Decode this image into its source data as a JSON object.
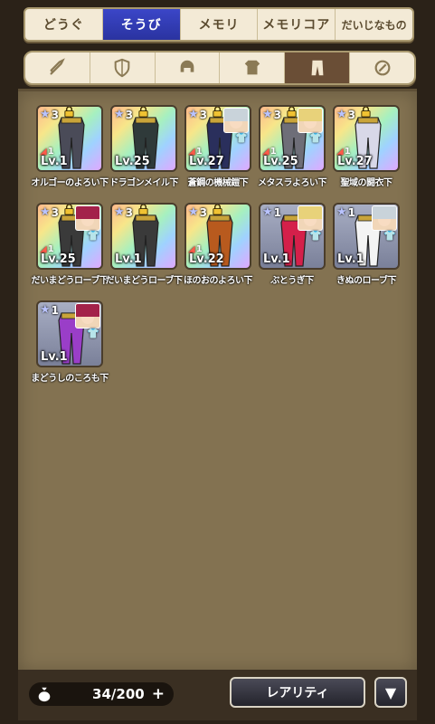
{
  "top_tabs": [
    {
      "label": "どうぐ",
      "active": false
    },
    {
      "label": "そうび",
      "active": true
    },
    {
      "label": "メモリ",
      "active": false
    },
    {
      "label": "メモリコア",
      "active": false
    },
    {
      "label": "だいじなもの",
      "active": false
    }
  ],
  "category_tabs": [
    {
      "icon": "sword-icon",
      "active": false
    },
    {
      "icon": "shield-icon",
      "active": false
    },
    {
      "icon": "helmet-icon",
      "active": false
    },
    {
      "icon": "armor-top-icon",
      "active": false
    },
    {
      "icon": "armor-bottom-icon",
      "active": true
    },
    {
      "icon": "accessory-icon",
      "active": false
    }
  ],
  "items": [
    {
      "name": "オルゴーのよろい下",
      "rarity": 3,
      "level": "Lv.1",
      "locked": true,
      "upgrade": "1",
      "portrait": null,
      "color": "#4a4b58"
    },
    {
      "name": "ドラゴンメイル下",
      "rarity": 3,
      "level": "Lv.25",
      "locked": true,
      "upgrade": null,
      "portrait": null,
      "color": "#2f3a3a"
    },
    {
      "name": "蒼鋼の機械鎧下",
      "rarity": 3,
      "level": "Lv.27",
      "locked": true,
      "upgrade": "1",
      "portrait": "silver",
      "color": "#2a2f5c"
    },
    {
      "name": "メタスラよろい下",
      "rarity": 3,
      "level": "Lv.25",
      "locked": true,
      "upgrade": "1",
      "portrait": "blonde",
      "color": "#6e6e78"
    },
    {
      "name": "聖域の闘衣下",
      "rarity": 3,
      "level": "Lv.27",
      "locked": true,
      "upgrade": "1",
      "portrait": null,
      "color": "#d8d8e8"
    },
    {
      "name": "だいまどうローブ下",
      "rarity": 3,
      "level": "Lv.25",
      "locked": true,
      "upgrade": "1",
      "portrait": "red",
      "color": "#3a3a3a"
    },
    {
      "name": "だいまどうローブ下",
      "rarity": 3,
      "level": "Lv.1",
      "locked": true,
      "upgrade": null,
      "portrait": null,
      "color": "#3a3a3a"
    },
    {
      "name": "ほのおのよろい下",
      "rarity": 3,
      "level": "Lv.22",
      "locked": true,
      "upgrade": "1",
      "portrait": null,
      "color": "#b85a1e"
    },
    {
      "name": "ぶとうぎ下",
      "rarity": 1,
      "level": "Lv.1",
      "locked": false,
      "upgrade": null,
      "portrait": "blonde",
      "color": "#d4204a"
    },
    {
      "name": "きぬのローブ下",
      "rarity": 1,
      "level": "Lv.1",
      "locked": false,
      "upgrade": null,
      "portrait": "silver",
      "color": "#f4f4f4"
    },
    {
      "name": "まどうしのころも下",
      "rarity": 1,
      "level": "Lv.1",
      "locked": false,
      "upgrade": null,
      "portrait": "red",
      "color": "#9a3ec8"
    }
  ],
  "footer": {
    "capacity": "34/200",
    "plus": "+",
    "sort_label": "レアリティ",
    "sort_order_icon": "▼"
  }
}
